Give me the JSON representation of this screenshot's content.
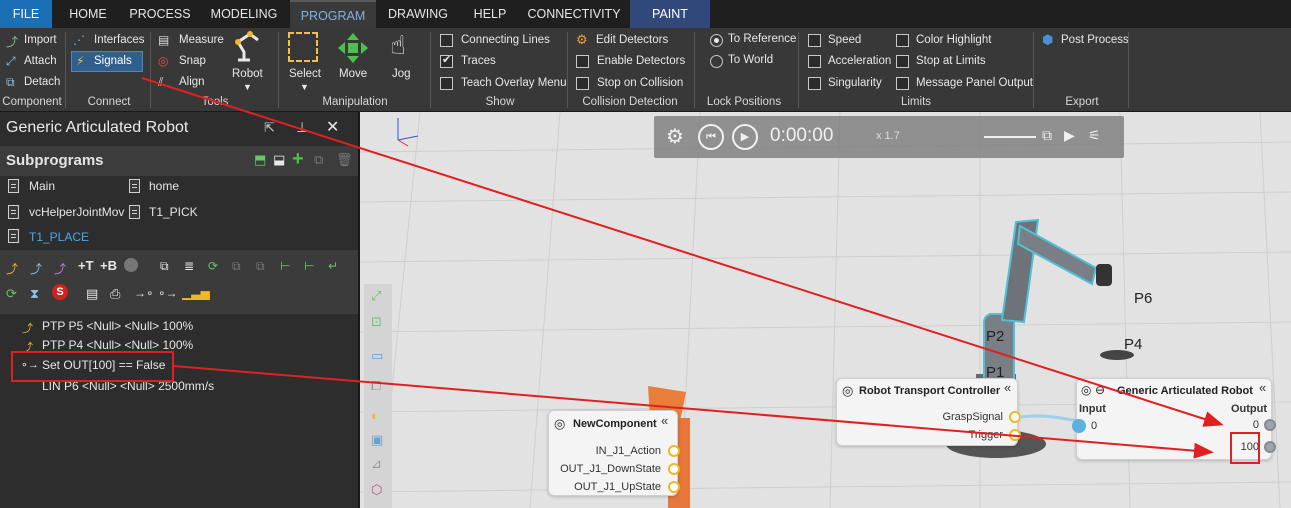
{
  "menu": {
    "file": "FILE",
    "home": "HOME",
    "process": "PROCESS",
    "modeling": "MODELING",
    "program": "PROGRAM",
    "drawing": "DRAWING",
    "help": "HELP",
    "connectivity": "CONNECTIVITY",
    "paint": "PAINT"
  },
  "ribbon": {
    "component": {
      "import": "Import",
      "attach": "Attach",
      "detach": "Detach",
      "group": "Component"
    },
    "connect": {
      "interfaces": "Interfaces",
      "signals": "Signals",
      "group": "Connect"
    },
    "tools": {
      "measure": "Measure",
      "snap": "Snap",
      "align": "Align",
      "robot": "Robot",
      "group": "Tools"
    },
    "manipulation": {
      "select": "Select",
      "move": "Move",
      "jog": "Jog",
      "group": "Manipulation"
    },
    "show": {
      "connecting_lines": "Connecting Lines",
      "traces": "Traces",
      "teach_overlay": "Teach Overlay Menu",
      "group": "Show"
    },
    "collision": {
      "edit_detectors": "Edit Detectors",
      "enable_detectors": "Enable Detectors",
      "stop_on_collision": "Stop on Collision",
      "group": "Collision Detection"
    },
    "lock": {
      "to_reference": "To Reference",
      "to_world": "To World",
      "group": "Lock Positions"
    },
    "limits": {
      "speed": "Speed",
      "acceleration": "Acceleration",
      "singularity": "Singularity",
      "color_highlight": "Color Highlight",
      "stop_at_limits": "Stop at Limits",
      "message_panel_output": "Message Panel Output",
      "group": "Limits"
    },
    "export": {
      "post_process": "Post Process",
      "group": "Export"
    }
  },
  "left_panel": {
    "title": "Generic Articulated Robot",
    "subprograms_title": "Subprograms",
    "subprograms": [
      "Main",
      "home",
      "vcHelperJointMov",
      "T1_PICK",
      "T1_PLACE"
    ],
    "statements": [
      "PTP P5 <Null> <Null> 100%",
      "PTP P4 <Null> <Null> 100%",
      "Set OUT[100] == False",
      "LIN P6 <Null> <Null> 2500mm/s"
    ]
  },
  "viewport": {
    "time": "0:00:00",
    "speed": "x 1.7",
    "points": [
      "P6",
      "P4",
      "P2",
      "P1"
    ],
    "new_component": {
      "title": "NewComponent",
      "ports": [
        "IN_J1_Action",
        "OUT_J1_DownState",
        "OUT_J1_UpState"
      ]
    },
    "transport_controller": {
      "title": "Robot Transport Controller",
      "ports": [
        "GraspSignal",
        "Trigger"
      ],
      "value": "0"
    },
    "robot_node": {
      "title": "Generic Articulated Robot",
      "input_label": "Input",
      "output_label": "Output",
      "output_values": [
        "0",
        "100"
      ]
    }
  },
  "colors": {
    "accent": "#1b6fb5",
    "paint_tab": "#31497a",
    "annotation": "#e02020",
    "port": "#f0b824",
    "selected_subprogram": "#4aa8e8"
  }
}
